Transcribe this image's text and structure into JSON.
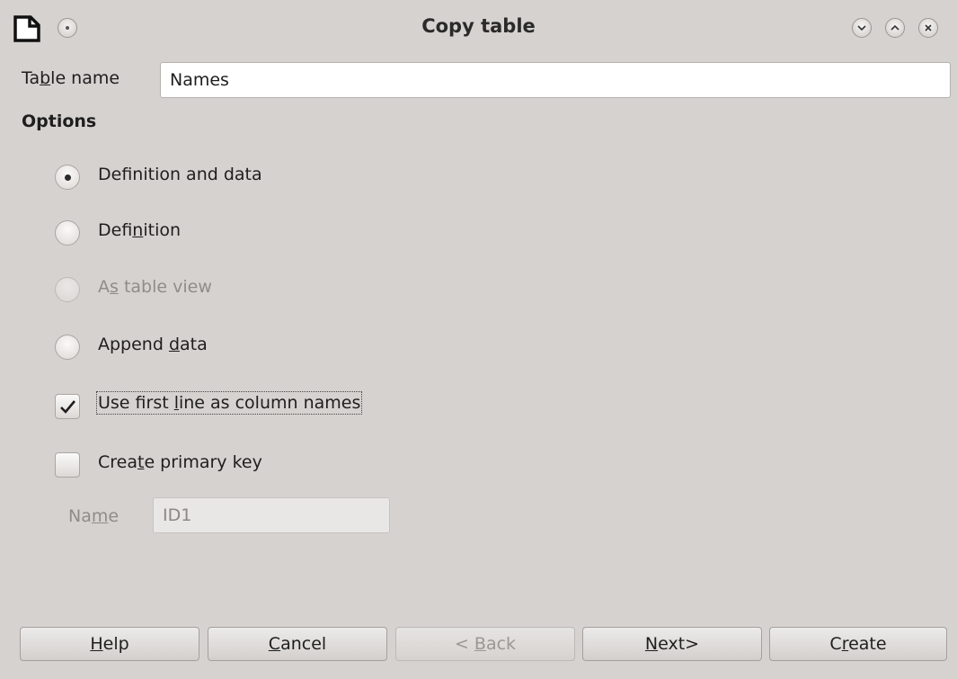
{
  "window": {
    "title": "Copy table"
  },
  "form": {
    "table_name_label_pre": "Ta",
    "table_name_label_u": "b",
    "table_name_label_post": "le name",
    "table_name_value": "Names",
    "options_heading": "Options",
    "options": [
      {
        "pre": "Def",
        "u": "i",
        "post": "nition and data",
        "checked": true,
        "disabled": false
      },
      {
        "pre": "Defi",
        "u": "n",
        "post": "ition",
        "checked": false,
        "disabled": false
      },
      {
        "pre": "A",
        "u": "s",
        "post": " table view",
        "checked": false,
        "disabled": true
      },
      {
        "pre": "Append ",
        "u": "d",
        "post": "ata",
        "checked": false,
        "disabled": false
      }
    ],
    "use_first_line": {
      "pre": "Use first ",
      "u": "l",
      "post": "ine as column names",
      "checked": true
    },
    "create_primary_key": {
      "pre": "Crea",
      "u": "t",
      "post": "e primary key",
      "checked": false
    },
    "key_name_label_pre": "Na",
    "key_name_label_u": "m",
    "key_name_label_post": "e",
    "key_name_value": "ID1"
  },
  "buttons": {
    "help": {
      "u": "H",
      "post": "elp"
    },
    "cancel": {
      "u": "C",
      "post": "ancel"
    },
    "back": {
      "pre": "< ",
      "u": "B",
      "post": "ack"
    },
    "next": {
      "u": "N",
      "post": "ext>"
    },
    "create": {
      "pre": "C",
      "u": "r",
      "post": "eate"
    }
  }
}
